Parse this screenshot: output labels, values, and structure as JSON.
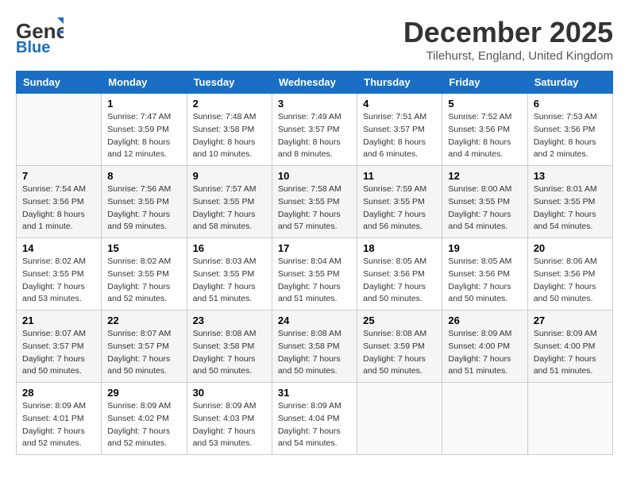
{
  "header": {
    "logo_general": "General",
    "logo_blue": "Blue",
    "month_title": "December 2025",
    "location": "Tilehurst, England, United Kingdom"
  },
  "days_of_week": [
    "Sunday",
    "Monday",
    "Tuesday",
    "Wednesday",
    "Thursday",
    "Friday",
    "Saturday"
  ],
  "weeks": [
    [
      {
        "day": "",
        "info": ""
      },
      {
        "day": "1",
        "info": "Sunrise: 7:47 AM\nSunset: 3:59 PM\nDaylight: 8 hours\nand 12 minutes."
      },
      {
        "day": "2",
        "info": "Sunrise: 7:48 AM\nSunset: 3:58 PM\nDaylight: 8 hours\nand 10 minutes."
      },
      {
        "day": "3",
        "info": "Sunrise: 7:49 AM\nSunset: 3:57 PM\nDaylight: 8 hours\nand 8 minutes."
      },
      {
        "day": "4",
        "info": "Sunrise: 7:51 AM\nSunset: 3:57 PM\nDaylight: 8 hours\nand 6 minutes."
      },
      {
        "day": "5",
        "info": "Sunrise: 7:52 AM\nSunset: 3:56 PM\nDaylight: 8 hours\nand 4 minutes."
      },
      {
        "day": "6",
        "info": "Sunrise: 7:53 AM\nSunset: 3:56 PM\nDaylight: 8 hours\nand 2 minutes."
      }
    ],
    [
      {
        "day": "7",
        "info": "Sunrise: 7:54 AM\nSunset: 3:56 PM\nDaylight: 8 hours\nand 1 minute."
      },
      {
        "day": "8",
        "info": "Sunrise: 7:56 AM\nSunset: 3:55 PM\nDaylight: 7 hours\nand 59 minutes."
      },
      {
        "day": "9",
        "info": "Sunrise: 7:57 AM\nSunset: 3:55 PM\nDaylight: 7 hours\nand 58 minutes."
      },
      {
        "day": "10",
        "info": "Sunrise: 7:58 AM\nSunset: 3:55 PM\nDaylight: 7 hours\nand 57 minutes."
      },
      {
        "day": "11",
        "info": "Sunrise: 7:59 AM\nSunset: 3:55 PM\nDaylight: 7 hours\nand 56 minutes."
      },
      {
        "day": "12",
        "info": "Sunrise: 8:00 AM\nSunset: 3:55 PM\nDaylight: 7 hours\nand 54 minutes."
      },
      {
        "day": "13",
        "info": "Sunrise: 8:01 AM\nSunset: 3:55 PM\nDaylight: 7 hours\nand 54 minutes."
      }
    ],
    [
      {
        "day": "14",
        "info": "Sunrise: 8:02 AM\nSunset: 3:55 PM\nDaylight: 7 hours\nand 53 minutes."
      },
      {
        "day": "15",
        "info": "Sunrise: 8:02 AM\nSunset: 3:55 PM\nDaylight: 7 hours\nand 52 minutes."
      },
      {
        "day": "16",
        "info": "Sunrise: 8:03 AM\nSunset: 3:55 PM\nDaylight: 7 hours\nand 51 minutes."
      },
      {
        "day": "17",
        "info": "Sunrise: 8:04 AM\nSunset: 3:55 PM\nDaylight: 7 hours\nand 51 minutes."
      },
      {
        "day": "18",
        "info": "Sunrise: 8:05 AM\nSunset: 3:56 PM\nDaylight: 7 hours\nand 50 minutes."
      },
      {
        "day": "19",
        "info": "Sunrise: 8:05 AM\nSunset: 3:56 PM\nDaylight: 7 hours\nand 50 minutes."
      },
      {
        "day": "20",
        "info": "Sunrise: 8:06 AM\nSunset: 3:56 PM\nDaylight: 7 hours\nand 50 minutes."
      }
    ],
    [
      {
        "day": "21",
        "info": "Sunrise: 8:07 AM\nSunset: 3:57 PM\nDaylight: 7 hours\nand 50 minutes."
      },
      {
        "day": "22",
        "info": "Sunrise: 8:07 AM\nSunset: 3:57 PM\nDaylight: 7 hours\nand 50 minutes."
      },
      {
        "day": "23",
        "info": "Sunrise: 8:08 AM\nSunset: 3:58 PM\nDaylight: 7 hours\nand 50 minutes."
      },
      {
        "day": "24",
        "info": "Sunrise: 8:08 AM\nSunset: 3:58 PM\nDaylight: 7 hours\nand 50 minutes."
      },
      {
        "day": "25",
        "info": "Sunrise: 8:08 AM\nSunset: 3:59 PM\nDaylight: 7 hours\nand 50 minutes."
      },
      {
        "day": "26",
        "info": "Sunrise: 8:09 AM\nSunset: 4:00 PM\nDaylight: 7 hours\nand 51 minutes."
      },
      {
        "day": "27",
        "info": "Sunrise: 8:09 AM\nSunset: 4:00 PM\nDaylight: 7 hours\nand 51 minutes."
      }
    ],
    [
      {
        "day": "28",
        "info": "Sunrise: 8:09 AM\nSunset: 4:01 PM\nDaylight: 7 hours\nand 52 minutes."
      },
      {
        "day": "29",
        "info": "Sunrise: 8:09 AM\nSunset: 4:02 PM\nDaylight: 7 hours\nand 52 minutes."
      },
      {
        "day": "30",
        "info": "Sunrise: 8:09 AM\nSunset: 4:03 PM\nDaylight: 7 hours\nand 53 minutes."
      },
      {
        "day": "31",
        "info": "Sunrise: 8:09 AM\nSunset: 4:04 PM\nDaylight: 7 hours\nand 54 minutes."
      },
      {
        "day": "",
        "info": ""
      },
      {
        "day": "",
        "info": ""
      },
      {
        "day": "",
        "info": ""
      }
    ]
  ]
}
